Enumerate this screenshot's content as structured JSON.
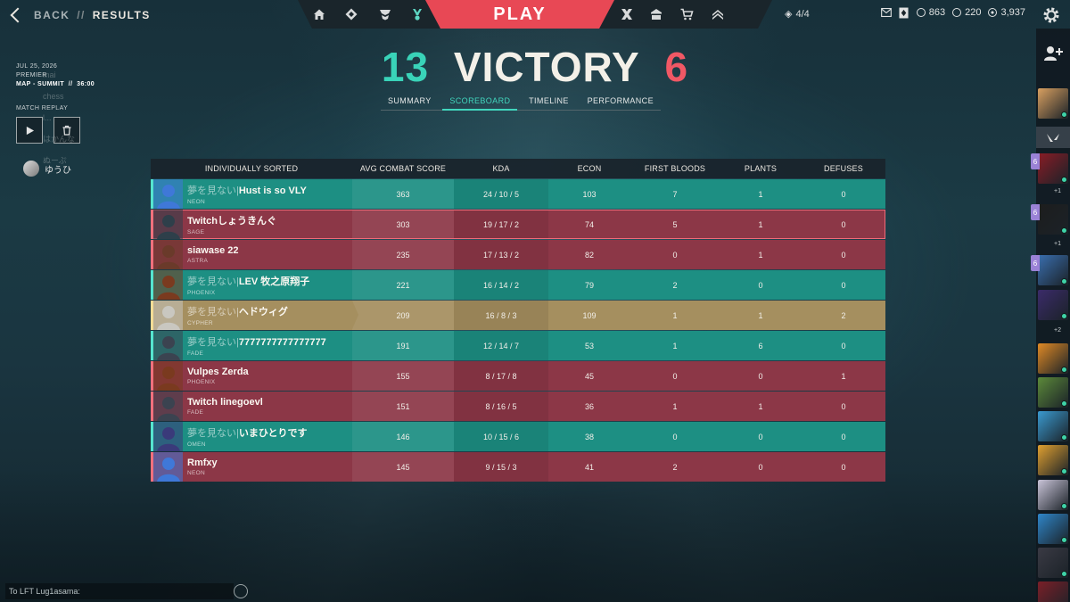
{
  "nav": {
    "back_label": "BACK",
    "separator": "//",
    "results_label": "RESULTS",
    "play_label": "PLAY",
    "tokens": "4/4",
    "currency": {
      "vp": "863",
      "radianite": "220",
      "kingdom": "3,937"
    }
  },
  "match": {
    "date": "JUL 25, 2026",
    "mode": "PREMIER",
    "map": "MAP - SUMMIT",
    "separator": "//",
    "duration": "36:00",
    "replay_label": "MATCH REPLAY",
    "party_name": "ゆうひ",
    "ghost_lines": [
      "mai",
      "chess",
      "l...",
      "はかんな",
      "ぬーぷ"
    ]
  },
  "result": {
    "team_score": "13",
    "outcome": "VICTORY",
    "enemy_score": "6"
  },
  "tabs": [
    "SUMMARY",
    "SCOREBOARD",
    "TIMELINE",
    "PERFORMANCE"
  ],
  "active_tab": "SCOREBOARD",
  "scoreboard": {
    "headers": [
      "INDIVIDUALLY SORTED",
      "AVG COMBAT SCORE",
      "KDA",
      "ECON",
      "FIRST BLOODS",
      "PLANTS",
      "DEFUSES"
    ],
    "rows": [
      {
        "tag": "夢を見ない|",
        "name": "Hust is so VLY",
        "agent": "NEON",
        "acs": "363",
        "kda": "24 / 10 / 5",
        "econ": "103",
        "fb": "7",
        "plants": "1",
        "defuses": "0",
        "team": "win",
        "color": "#3f78d8"
      },
      {
        "tag": "",
        "name": "Twitchしょうきんぐ",
        "agent": "SAGE",
        "acs": "303",
        "kda": "19 / 17 / 2",
        "econ": "74",
        "fb": "5",
        "plants": "1",
        "defuses": "0",
        "team": "lose",
        "highlight": true,
        "color": "#2e3f4a"
      },
      {
        "tag": "",
        "name": "siawase 22",
        "agent": "ASTRA",
        "acs": "235",
        "kda": "17 / 13 / 2",
        "econ": "82",
        "fb": "0",
        "plants": "1",
        "defuses": "0",
        "team": "lose",
        "color": "#6a3a2a"
      },
      {
        "tag": "夢を見ない|",
        "name": "LEV 牧之原翔子",
        "agent": "PHOENIX",
        "acs": "221",
        "kda": "16 / 14 / 2",
        "econ": "79",
        "fb": "2",
        "plants": "0",
        "defuses": "0",
        "team": "win",
        "color": "#7a3a1f"
      },
      {
        "tag": "夢を見ない|",
        "name": "ヘドウィグ",
        "agent": "CYPHER",
        "acs": "209",
        "kda": "16 / 8 / 3",
        "econ": "109",
        "fb": "1",
        "plants": "1",
        "defuses": "2",
        "team": "self",
        "color": "#c9c7c0"
      },
      {
        "tag": "夢を見ない|",
        "name": "7777777777777777",
        "agent": "FADE",
        "acs": "191",
        "kda": "12 / 14 / 7",
        "econ": "53",
        "fb": "1",
        "plants": "6",
        "defuses": "0",
        "team": "win",
        "color": "#3b4350"
      },
      {
        "tag": "",
        "name": "Vulpes Zerda",
        "agent": "PHOENIX",
        "acs": "155",
        "kda": "8 / 17 / 8",
        "econ": "45",
        "fb": "0",
        "plants": "0",
        "defuses": "1",
        "team": "lose",
        "color": "#7a3a1f"
      },
      {
        "tag": "",
        "name": "Twitch linegoevl",
        "agent": "FADE",
        "acs": "151",
        "kda": "8 / 16 / 5",
        "econ": "36",
        "fb": "1",
        "plants": "1",
        "defuses": "0",
        "team": "lose",
        "color": "#3b4350"
      },
      {
        "tag": "夢を見ない|",
        "name": "いまひとりです",
        "agent": "OMEN",
        "acs": "146",
        "kda": "10 / 15 / 6",
        "econ": "38",
        "fb": "0",
        "plants": "0",
        "defuses": "0",
        "team": "win",
        "color": "#3a3a7a"
      },
      {
        "tag": "",
        "name": "Rmfxy",
        "agent": "NEON",
        "acs": "145",
        "kda": "9 / 15 / 3",
        "econ": "41",
        "fb": "2",
        "plants": "0",
        "defuses": "0",
        "team": "lose",
        "color": "#3f78d8"
      }
    ]
  },
  "social": {
    "group_counts": [
      "+1",
      "+1",
      "+2"
    ],
    "group_count_labels": [
      "6",
      "6",
      "6"
    ],
    "friends": [
      {
        "color": "#d9a060"
      },
      {
        "color": "#8a1c26"
      },
      {
        "color": "#1d1d1d"
      },
      {
        "color": "#3a6fb0"
      },
      {
        "color": "#3b2b6a"
      },
      {
        "color": "#e08a25"
      },
      {
        "color": "#5c8a3a"
      },
      {
        "color": "#3a9ad0"
      },
      {
        "color": "#e0a030"
      },
      {
        "color": "#c9c4d8"
      },
      {
        "color": "#2f86c9"
      },
      {
        "color": "#3a3a44"
      },
      {
        "color": "#7a1f28"
      }
    ]
  },
  "chat": {
    "placeholder": "To LFT Lug1asama:"
  }
}
